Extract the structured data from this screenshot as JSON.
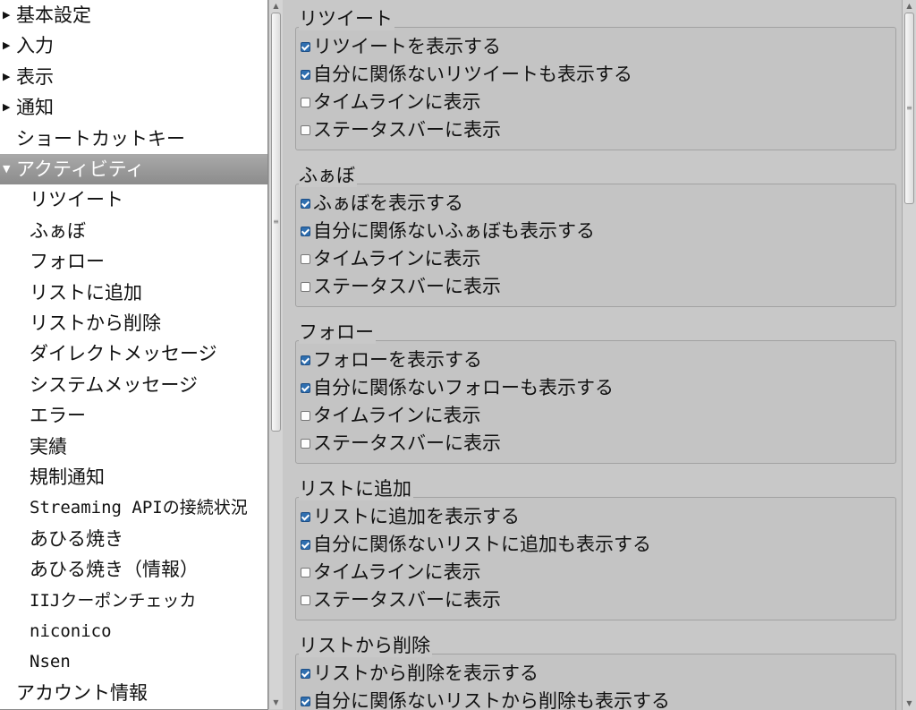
{
  "tree": {
    "items": [
      {
        "label": "基本設定",
        "level": 0,
        "arrow": "▶",
        "selected": false,
        "mono": false
      },
      {
        "label": "入力",
        "level": 0,
        "arrow": "▶",
        "selected": false,
        "mono": false
      },
      {
        "label": "表示",
        "level": 0,
        "arrow": "▶",
        "selected": false,
        "mono": false
      },
      {
        "label": "通知",
        "level": 0,
        "arrow": "▶",
        "selected": false,
        "mono": false
      },
      {
        "label": "ショートカットキー",
        "level": 0,
        "arrow": "",
        "selected": false,
        "mono": false
      },
      {
        "label": "アクティビティ",
        "level": 0,
        "arrow": "▼",
        "selected": true,
        "mono": false
      },
      {
        "label": "リツイート",
        "level": 1,
        "arrow": "",
        "selected": false,
        "mono": false
      },
      {
        "label": "ふぁぼ",
        "level": 1,
        "arrow": "",
        "selected": false,
        "mono": false
      },
      {
        "label": "フォロー",
        "level": 1,
        "arrow": "",
        "selected": false,
        "mono": false
      },
      {
        "label": "リストに追加",
        "level": 1,
        "arrow": "",
        "selected": false,
        "mono": false
      },
      {
        "label": "リストから削除",
        "level": 1,
        "arrow": "",
        "selected": false,
        "mono": false
      },
      {
        "label": "ダイレクトメッセージ",
        "level": 1,
        "arrow": "",
        "selected": false,
        "mono": false
      },
      {
        "label": "システムメッセージ",
        "level": 1,
        "arrow": "",
        "selected": false,
        "mono": false
      },
      {
        "label": "エラー",
        "level": 1,
        "arrow": "",
        "selected": false,
        "mono": false
      },
      {
        "label": "実績",
        "level": 1,
        "arrow": "",
        "selected": false,
        "mono": false
      },
      {
        "label": "規制通知",
        "level": 1,
        "arrow": "",
        "selected": false,
        "mono": false
      },
      {
        "label": "Streaming APIの接続状況",
        "level": 1,
        "arrow": "",
        "selected": false,
        "mono": true
      },
      {
        "label": "あひる焼き",
        "level": 1,
        "arrow": "",
        "selected": false,
        "mono": false
      },
      {
        "label": "あひる焼き（情報）",
        "level": 1,
        "arrow": "",
        "selected": false,
        "mono": false
      },
      {
        "label": "IIJクーポンチェッカ",
        "level": 1,
        "arrow": "",
        "selected": false,
        "mono": true
      },
      {
        "label": "niconico",
        "level": 1,
        "arrow": "",
        "selected": false,
        "mono": true
      },
      {
        "label": "Nsen",
        "level": 1,
        "arrow": "",
        "selected": false,
        "mono": true
      },
      {
        "label": "アカウント情報",
        "level": 0,
        "arrow": "",
        "selected": false,
        "mono": false
      }
    ]
  },
  "groups": [
    {
      "title": "リツイート",
      "options": [
        {
          "label": "リツイートを表示する",
          "checked": true
        },
        {
          "label": "自分に関係ないリツイートも表示する",
          "checked": true
        },
        {
          "label": "タイムラインに表示",
          "checked": false
        },
        {
          "label": "ステータスバーに表示",
          "checked": false
        }
      ]
    },
    {
      "title": "ふぁぼ",
      "options": [
        {
          "label": "ふぁぼを表示する",
          "checked": true
        },
        {
          "label": "自分に関係ないふぁぼも表示する",
          "checked": true
        },
        {
          "label": "タイムラインに表示",
          "checked": false
        },
        {
          "label": "ステータスバーに表示",
          "checked": false
        }
      ]
    },
    {
      "title": "フォロー",
      "options": [
        {
          "label": "フォローを表示する",
          "checked": true
        },
        {
          "label": "自分に関係ないフォローも表示する",
          "checked": true
        },
        {
          "label": "タイムラインに表示",
          "checked": false
        },
        {
          "label": "ステータスバーに表示",
          "checked": false
        }
      ]
    },
    {
      "title": "リストに追加",
      "options": [
        {
          "label": "リストに追加を表示する",
          "checked": true
        },
        {
          "label": "自分に関係ないリストに追加も表示する",
          "checked": true
        },
        {
          "label": "タイムラインに表示",
          "checked": false
        },
        {
          "label": "ステータスバーに表示",
          "checked": false
        }
      ]
    },
    {
      "title": "リストから削除",
      "options": [
        {
          "label": "リストから削除を表示する",
          "checked": true
        },
        {
          "label": "自分に関係ないリストから削除も表示する",
          "checked": true
        }
      ]
    }
  ],
  "icons": {
    "scroll_up": "▲",
    "scroll_down": "▼",
    "grip": "≡"
  }
}
